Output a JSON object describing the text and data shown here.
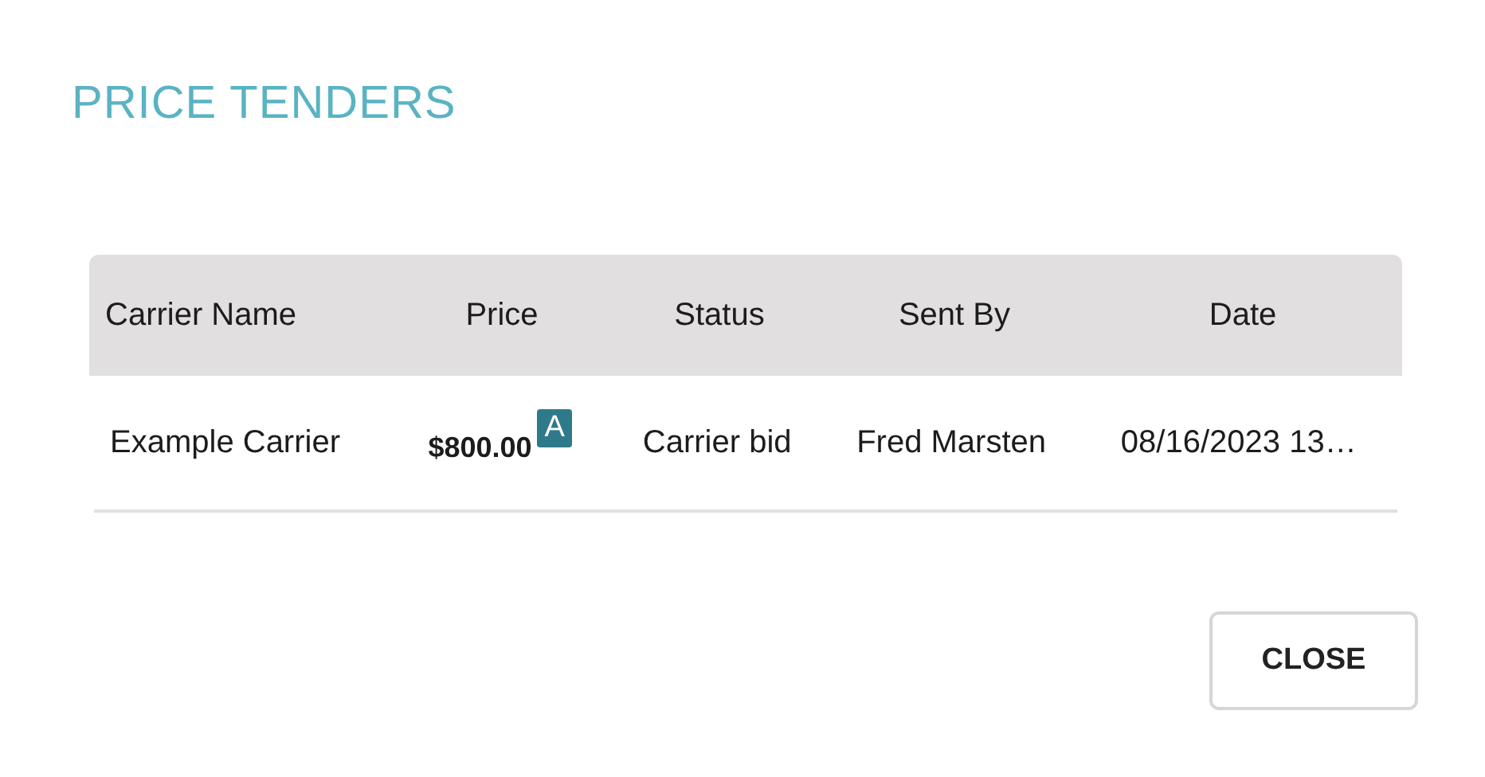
{
  "title": "PRICE TENDERS",
  "table": {
    "columns": [
      "Carrier Name",
      "Price",
      "Status",
      "Sent By",
      "Date"
    ],
    "rows": [
      {
        "carrier": "Example Carrier",
        "price": "$800.00",
        "price_badge": "A",
        "status": "Carrier bid",
        "sent_by": "Fred Marsten",
        "date": "08/16/2023 13…"
      }
    ]
  },
  "buttons": [
    "CLOSE"
  ]
}
